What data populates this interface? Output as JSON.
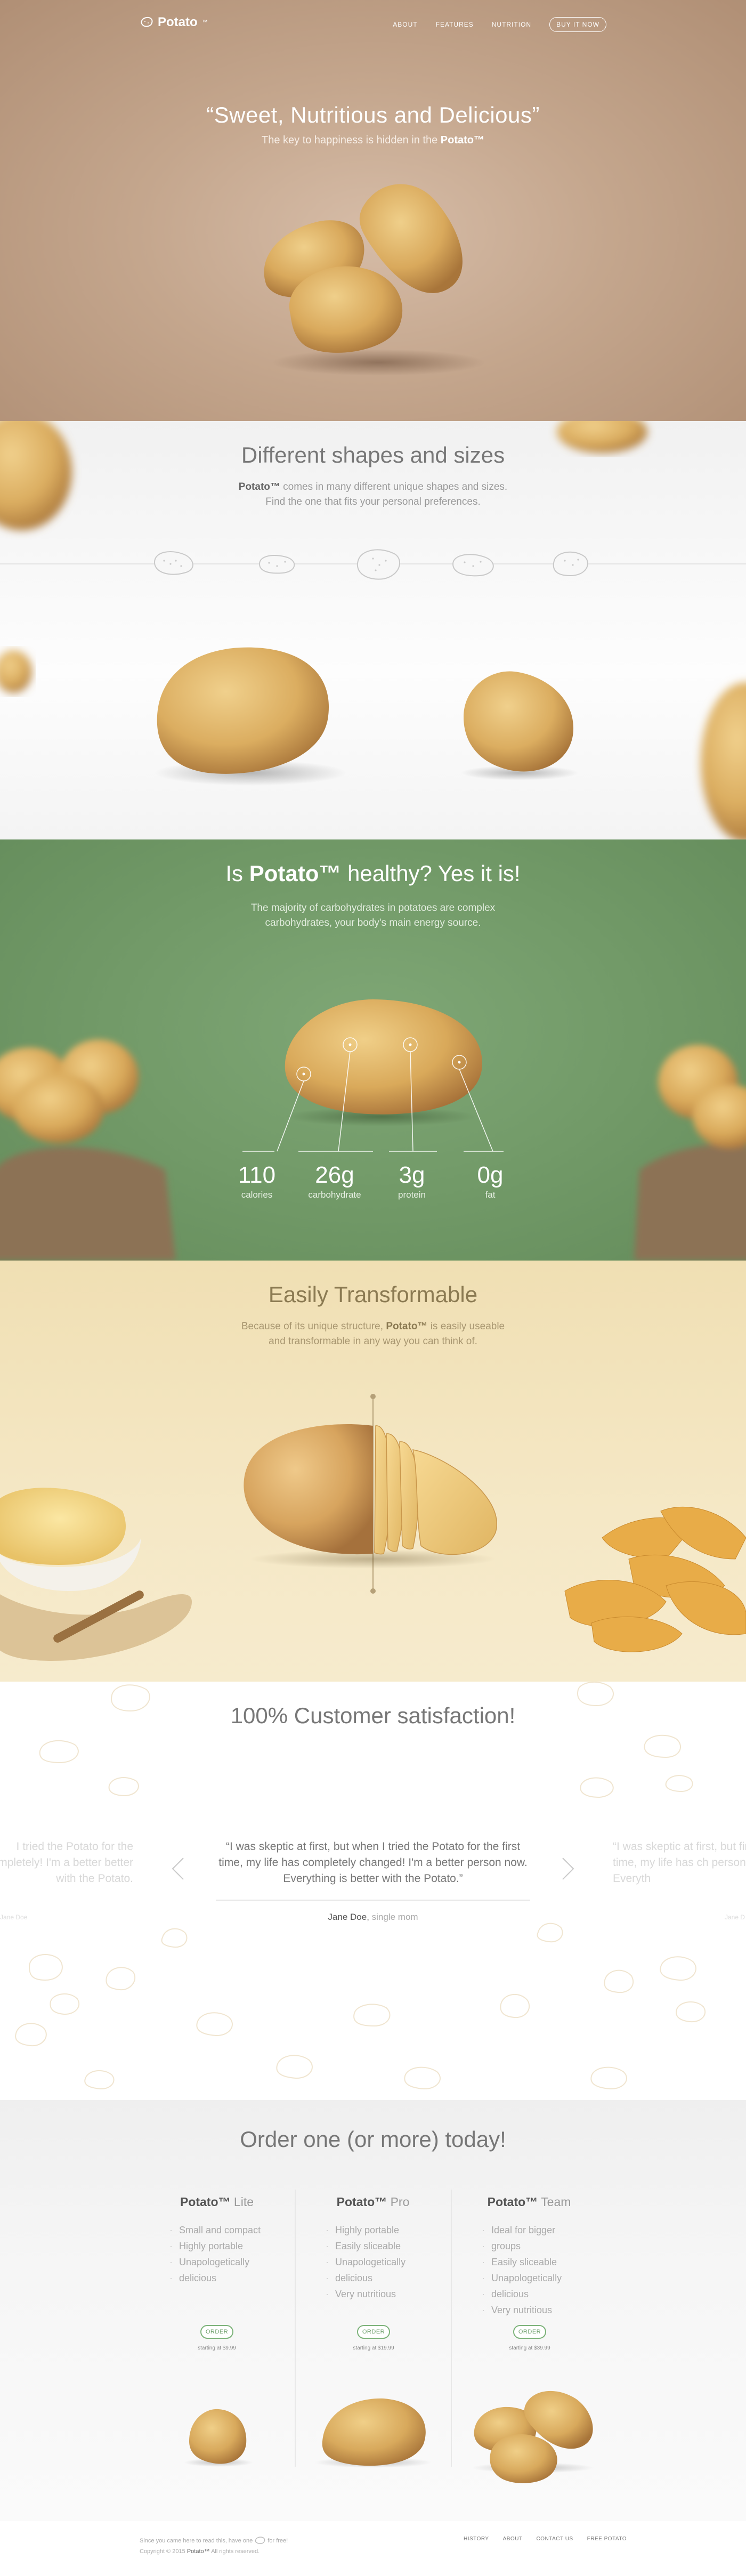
{
  "brand": {
    "name": "Potato",
    "tm": "™"
  },
  "nav": {
    "items": [
      "ABOUT",
      "FEATURES",
      "NUTRITION"
    ],
    "buy": "BUY IT NOW"
  },
  "hero": {
    "title": "“Sweet, Nutritious and Delicious”",
    "subtitle_pre": "The key to happiness is hidden in the ",
    "subtitle_brand": "Potato™"
  },
  "shapes": {
    "title": "Different shapes and sizes",
    "text_brand": "Potato™",
    "text_line1": " comes in many different unique shapes and sizes.",
    "text_line2": "Find the one that fits your personal preferences."
  },
  "health": {
    "title_pre": "Is ",
    "title_brand": "Potato™",
    "title_post": " healthy? Yes it is!",
    "text_line1": "The majority of carbohydrates in potatoes are complex",
    "text_line2": "carbohydrates, your body's main energy source.",
    "stats": [
      {
        "value": "110",
        "label": "calories"
      },
      {
        "value": "26g",
        "label": "carbohydrate"
      },
      {
        "value": "3g",
        "label": "protein"
      },
      {
        "value": "0g",
        "label": "fat"
      }
    ]
  },
  "transform": {
    "title": "Easily Transformable",
    "text_pre": "Because of its unique structure, ",
    "text_brand": "Potato™",
    "text_post": " is easily useable",
    "text_line2": "and transformable in any way you can think of."
  },
  "testimonials": {
    "title": "100% Customer satisfaction!",
    "quote": "“I was skeptic at first, but when I tried the Potato for the first time, my life has completely changed! I'm a better person now. Everything is better with the Potato.”",
    "author": "Jane Doe",
    "author_role": "single mom",
    "ghost_left": "I tried the Potato for the completely! I'm a better better with the Potato.",
    "ghost_right": "“I was skeptic at first, but first time, my life has ch person now. Everyth",
    "ghost_left_author": "Jane Doe",
    "ghost_right_author": "Jane D"
  },
  "pricing": {
    "title": "Order one (or more) today!",
    "plans": [
      {
        "brand": "Potato™",
        "tier": " Lite",
        "features": [
          "Small and compact",
          "Highly portable",
          "Unapologetically",
          "delicious"
        ],
        "button": "ORDER",
        "price": "starting at $9.99"
      },
      {
        "brand": "Potato™",
        "tier": " Pro",
        "features": [
          "Highly portable",
          "Easily sliceable",
          "Unapologetically",
          "delicious",
          "Very nutritious"
        ],
        "button": "ORDER",
        "price": "starting at $19.99"
      },
      {
        "brand": "Potato™",
        "tier": " Team",
        "features": [
          "Ideal for bigger",
          "groups",
          "Easily sliceable",
          "Unapologetically",
          "delicious",
          "Very nutritious"
        ],
        "button": "ORDER",
        "price": "starting at $39.99"
      }
    ]
  },
  "footer": {
    "line1_pre": "Since you came here to read this, have one",
    "line1_post": "for free!",
    "copyright_pre": "Copyright © 2015 ",
    "copyright_brand": "Potato™",
    "copyright_post": " All rights reserved.",
    "links": [
      "HISTORY",
      "ABOUT",
      "CONTACT US",
      "FREE POTATO"
    ]
  },
  "colors": {
    "hero": "#c4a68d",
    "health": "#729a68",
    "transform": "#f3e4bf",
    "accent_green": "#7db37a"
  }
}
